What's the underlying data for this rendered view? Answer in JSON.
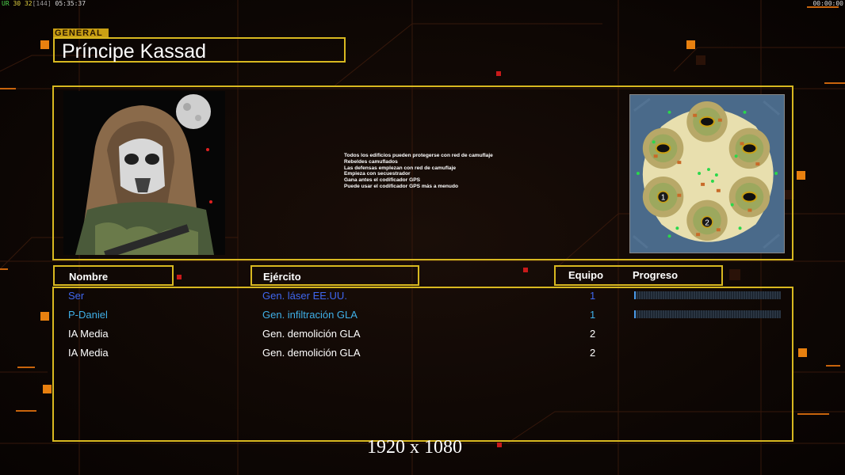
{
  "hud": {
    "fps_label": "UR",
    "fps_value": "30",
    "fps_value2": "32",
    "fps_bracket": "[144]",
    "clock": "05:35:37",
    "timer": "00:00:00"
  },
  "general": {
    "tag": "GENERAL",
    "name": "Príncipe Kassad"
  },
  "objectives": [
    "Todos los edificios pueden protegerse con red de camuflaje",
    "Rebeldes camuflados",
    "Las defensas emplezan con red de camuflaje",
    "Empieza con secuestrador",
    "Gana antes el codificador GPS",
    "Puede usar el codificador GPS más a menudo"
  ],
  "minimap": {
    "start_positions": [
      "1",
      "2"
    ]
  },
  "columns": {
    "name": "Nombre",
    "army": "Ejército",
    "team": "Equipo",
    "progress": "Progreso"
  },
  "players": [
    {
      "name": "Ser",
      "army": "Gen. láser EE.UU.",
      "team": "1",
      "color": "#3f67ef",
      "progress": 0.01
    },
    {
      "name": "P-Daniel",
      "army": "Gen. infiltración GLA",
      "team": "1",
      "color": "#3fb0e8",
      "progress": 0.01
    },
    {
      "name": "IA Media",
      "army": "Gen. demolición GLA",
      "team": "2",
      "color": "#ffffff"
    },
    {
      "name": "IA Media",
      "army": "Gen. demolición GLA",
      "team": "2",
      "color": "#ffffff"
    }
  ],
  "resolution_caption": "1920 x 1080"
}
